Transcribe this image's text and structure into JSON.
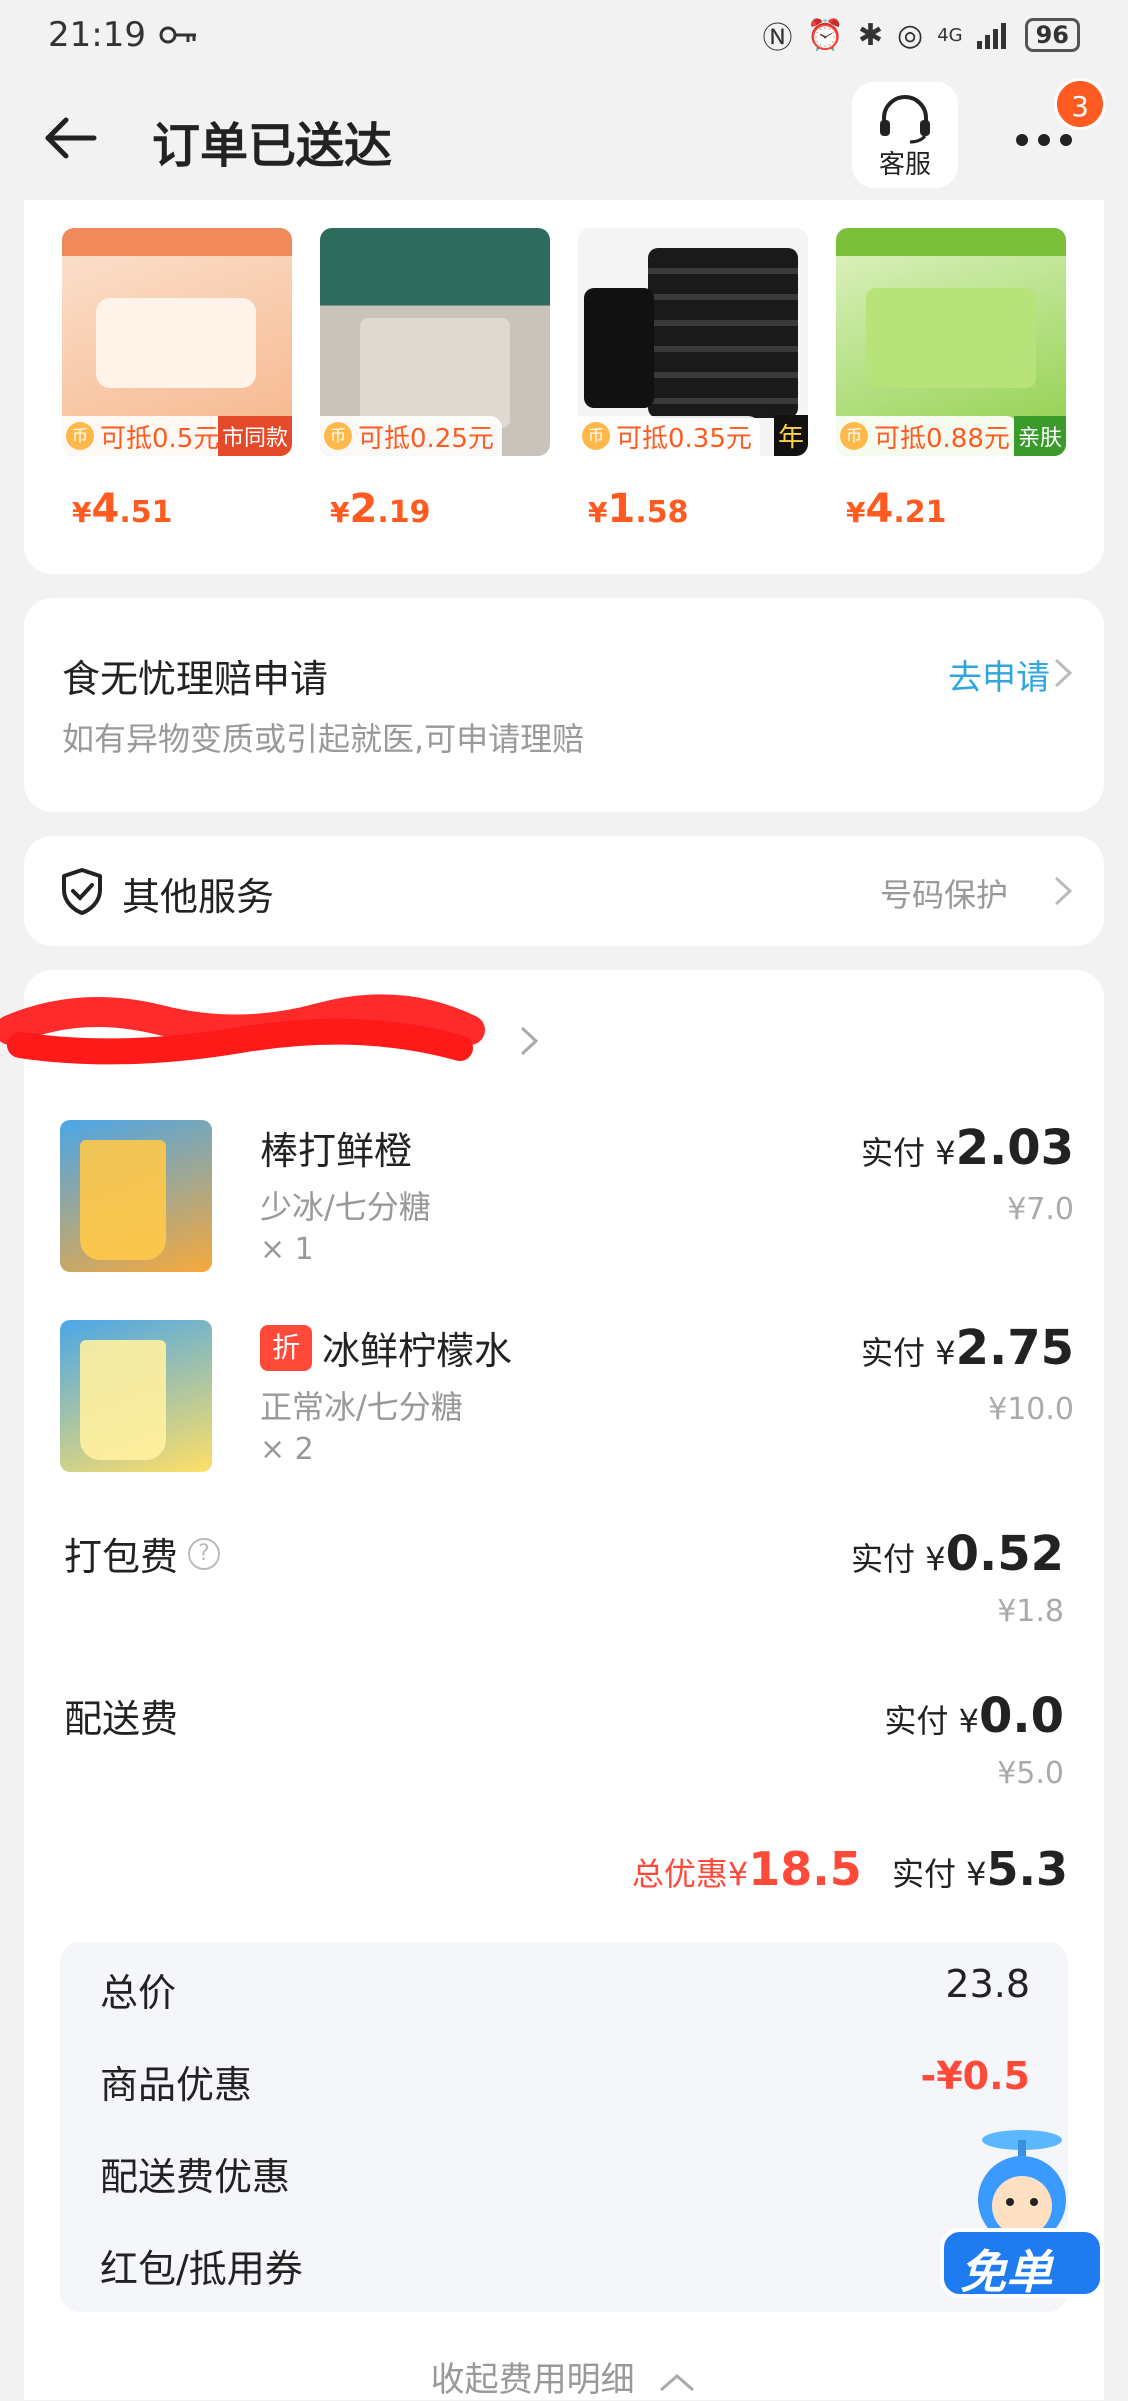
{
  "status_bar": {
    "time": "21:19",
    "battery": "96",
    "network": "4G"
  },
  "header": {
    "title": "订单已送达",
    "customer_service_label": "客服",
    "more_badge_count": "3"
  },
  "recommendations": [
    {
      "deduct": "可抵0.5元",
      "price_int": "4",
      "price_dec": ".51",
      "corner_tag": "市同款"
    },
    {
      "deduct": "可抵0.25元",
      "price_int": "2",
      "price_dec": ".19",
      "corner_tag": ""
    },
    {
      "deduct": "可抵0.35元",
      "price_int": "1",
      "price_dec": ".58",
      "corner_tag": "年"
    },
    {
      "deduct": "可抵0.88元",
      "price_int": "4",
      "price_dec": ".21",
      "corner_tag": "亲肤"
    }
  ],
  "currency_symbol": "¥",
  "claim": {
    "title": "食无忧理赔申请",
    "subtitle": "如有异物变质或引起就医,可申请理赔",
    "link": "去申请"
  },
  "services": {
    "title": "其他服务",
    "value": "号码保护"
  },
  "order": {
    "paid_label": "实付",
    "items": [
      {
        "name": "棒打鲜橙",
        "spec": "少冰/七分糖",
        "qty": "× 1",
        "paid": "2.03",
        "original": "¥7.0",
        "discount_tag": ""
      },
      {
        "name": "冰鲜柠檬水",
        "spec": "正常冰/七分糖",
        "qty": "× 2",
        "paid": "2.75",
        "original": "¥10.0",
        "discount_tag": "折"
      }
    ],
    "packing_fee": {
      "label": "打包费",
      "paid": "0.52",
      "original": "¥1.8"
    },
    "delivery_fee": {
      "label": "配送费",
      "paid": "0.0",
      "original": "¥5.0"
    },
    "total_discount_label": "总优惠",
    "total_discount": "18.5",
    "total_paid": "5.3",
    "breakdown": [
      {
        "label": "总价",
        "value": "23.8"
      },
      {
        "label": "商品优惠",
        "value": "-¥0.5"
      },
      {
        "label": "配送费优惠",
        "value": "-"
      },
      {
        "label": "红包/抵用券",
        "value": "-"
      }
    ],
    "free_badge": "免单",
    "collapse_label": "收起费用明细"
  },
  "colors": {
    "accent": "#ff5a1f",
    "discount_red": "#ff4a3a",
    "link_blue": "#2fa6e0"
  }
}
